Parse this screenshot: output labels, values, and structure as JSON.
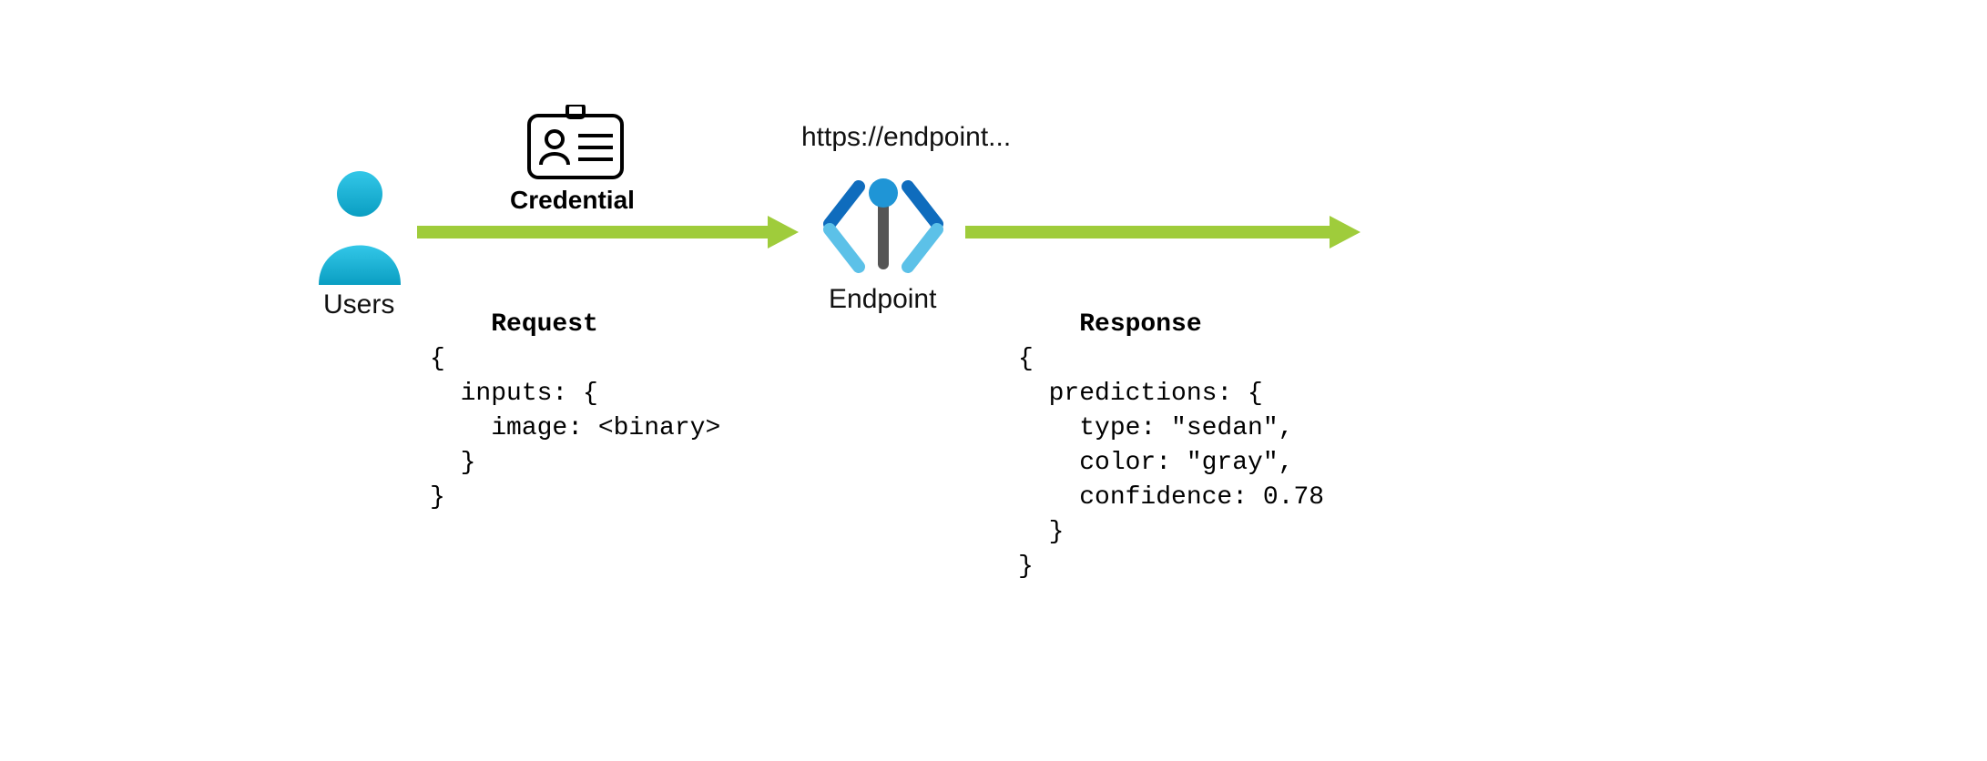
{
  "users_label": "Users",
  "credential_label": "Credential",
  "endpoint_url_label": "https://endpoint...",
  "endpoint_label": "Endpoint",
  "request": {
    "title": "Request",
    "l1": "{",
    "l2": "  inputs: {",
    "l3": "    image: <binary>",
    "l4": "  }",
    "l5": "}"
  },
  "response": {
    "title": "Response",
    "l1": "{",
    "l2": "  predictions: {",
    "l3": "    type: \"sedan\",",
    "l4": "    color: \"gray\",",
    "l5": "    confidence: 0.78",
    "l6": "  }",
    "l7": "}"
  },
  "colors": {
    "arrow": "#9fcc3b",
    "user_fill": "#1fb6d9",
    "endpoint_dark": "#0f6cbd",
    "endpoint_light": "#5cc1e8",
    "endpoint_stem": "#555555"
  }
}
